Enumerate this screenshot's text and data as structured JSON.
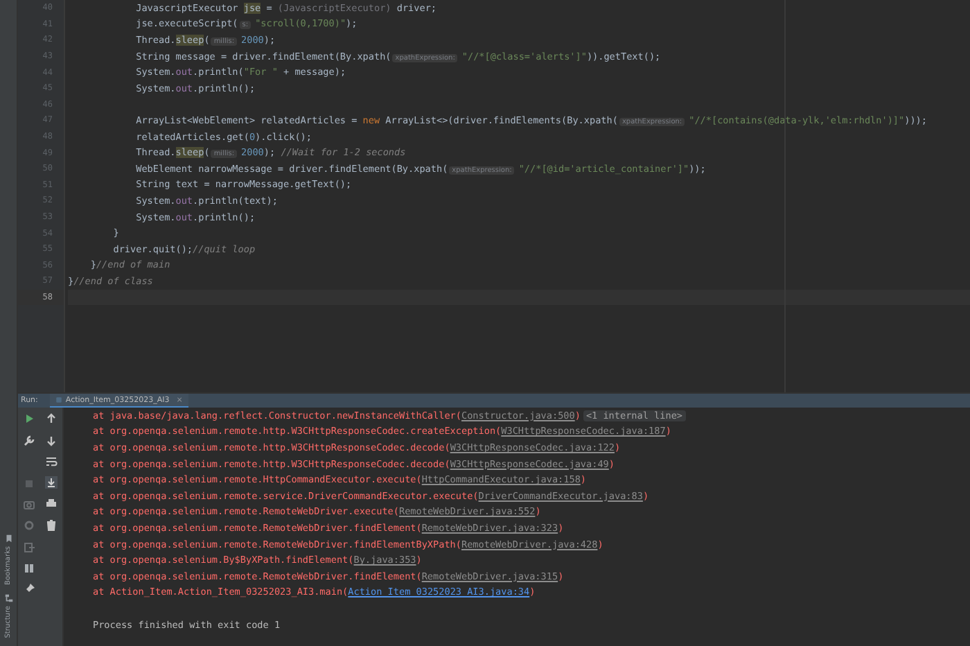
{
  "editor": {
    "lines": [
      {
        "number": "40",
        "current": false,
        "segments": [
          {
            "kind": "plain",
            "text": "            JavascriptExecutor "
          },
          {
            "kind": "highlight",
            "text": "jse"
          },
          {
            "kind": "plain",
            "text": " = "
          },
          {
            "kind": "dim",
            "text": "(JavascriptExecutor)"
          },
          {
            "kind": "plain",
            "text": " driver;"
          }
        ]
      },
      {
        "number": "41",
        "current": false,
        "segments": [
          {
            "kind": "plain",
            "text": "            jse.executeScript("
          },
          {
            "kind": "hint",
            "text": "s:"
          },
          {
            "kind": "string",
            "text": "\"scroll(0,1700)\""
          },
          {
            "kind": "plain",
            "text": ");"
          }
        ]
      },
      {
        "number": "42",
        "current": false,
        "segments": [
          {
            "kind": "plain",
            "text": "            Thread."
          },
          {
            "kind": "highlight",
            "text": "sleep"
          },
          {
            "kind": "plain",
            "text": "("
          },
          {
            "kind": "hint",
            "text": "millis:"
          },
          {
            "kind": "number",
            "text": "2000"
          },
          {
            "kind": "plain",
            "text": ");"
          }
        ]
      },
      {
        "number": "43",
        "current": false,
        "segments": [
          {
            "kind": "plain",
            "text": "            String message = driver.findElement(By.xpath("
          },
          {
            "kind": "hint",
            "text": "xpathExpression:"
          },
          {
            "kind": "string",
            "text": "\"//*[@class='alerts']\""
          },
          {
            "kind": "plain",
            "text": ")).getText();"
          }
        ]
      },
      {
        "number": "44",
        "current": false,
        "segments": [
          {
            "kind": "plain",
            "text": "            System."
          },
          {
            "kind": "field",
            "text": "out"
          },
          {
            "kind": "plain",
            "text": ".println("
          },
          {
            "kind": "string",
            "text": "\"For \""
          },
          {
            "kind": "plain",
            "text": " + message);"
          }
        ]
      },
      {
        "number": "45",
        "current": false,
        "segments": [
          {
            "kind": "plain",
            "text": "            System."
          },
          {
            "kind": "field",
            "text": "out"
          },
          {
            "kind": "plain",
            "text": ".println();"
          }
        ]
      },
      {
        "number": "46",
        "current": false
      },
      {
        "number": "47",
        "current": false,
        "segments": [
          {
            "kind": "plain",
            "text": "            ArrayList<WebElement> relatedArticles = "
          },
          {
            "kind": "keyword",
            "text": "new"
          },
          {
            "kind": "plain",
            "text": " ArrayList<>(driver.findElements(By.xpath("
          },
          {
            "kind": "hint",
            "text": "xpathExpression:"
          },
          {
            "kind": "string",
            "text": "\"//*[contains(@data-ylk,'elm:rhdln')]\""
          },
          {
            "kind": "plain",
            "text": ")));"
          }
        ]
      },
      {
        "number": "48",
        "current": false,
        "segments": [
          {
            "kind": "plain",
            "text": "            relatedArticles.get("
          },
          {
            "kind": "number",
            "text": "0"
          },
          {
            "kind": "plain",
            "text": ").click();"
          }
        ]
      },
      {
        "number": "49",
        "current": false,
        "segments": [
          {
            "kind": "plain",
            "text": "            Thread."
          },
          {
            "kind": "highlight",
            "text": "sleep"
          },
          {
            "kind": "plain",
            "text": "("
          },
          {
            "kind": "hint",
            "text": "millis:"
          },
          {
            "kind": "number",
            "text": "2000"
          },
          {
            "kind": "plain",
            "text": "); "
          },
          {
            "kind": "comment",
            "text": "//Wait for 1-2 seconds"
          }
        ]
      },
      {
        "number": "50",
        "current": false,
        "segments": [
          {
            "kind": "plain",
            "text": "            WebElement narrowMessage = driver.findElement(By.xpath("
          },
          {
            "kind": "hint",
            "text": "xpathExpression:"
          },
          {
            "kind": "string",
            "text": "\"//*[@id='article_container']\""
          },
          {
            "kind": "plain",
            "text": "));"
          }
        ]
      },
      {
        "number": "51",
        "current": false,
        "segments": [
          {
            "kind": "plain",
            "text": "            String text = narrowMessage.getText();"
          }
        ]
      },
      {
        "number": "52",
        "current": false,
        "segments": [
          {
            "kind": "plain",
            "text": "            System."
          },
          {
            "kind": "field",
            "text": "out"
          },
          {
            "kind": "plain",
            "text": ".println(text);"
          }
        ]
      },
      {
        "number": "53",
        "current": false,
        "segments": [
          {
            "kind": "plain",
            "text": "            System."
          },
          {
            "kind": "field",
            "text": "out"
          },
          {
            "kind": "plain",
            "text": ".println();"
          }
        ]
      },
      {
        "number": "54",
        "current": false,
        "segments": [
          {
            "kind": "plain",
            "text": "        }"
          }
        ]
      },
      {
        "number": "55",
        "current": false,
        "segments": [
          {
            "kind": "plain",
            "text": "        driver.quit();"
          },
          {
            "kind": "comment",
            "text": "//quit loop"
          }
        ]
      },
      {
        "number": "56",
        "current": false,
        "segments": [
          {
            "kind": "plain",
            "text": "    }"
          },
          {
            "kind": "comment",
            "text": "//end of main"
          }
        ]
      },
      {
        "number": "57",
        "current": false,
        "segments": [
          {
            "kind": "plain",
            "text": "}"
          },
          {
            "kind": "comment",
            "text": "//end of class"
          }
        ]
      },
      {
        "number": "58",
        "current": true
      }
    ]
  },
  "run_panel": {
    "label": "Run:",
    "tabs": [
      {
        "label": "Action_Item_03252023_AI3",
        "close": "×",
        "selected": true
      }
    ],
    "console": [
      {
        "kind": "error",
        "text": "at java.base/java.lang.reflect.Constructor.newInstanceWithCaller(",
        "link": "Constructor.java:500",
        "project_link": false,
        "tail": ")",
        "note": "<1 internal line>"
      },
      {
        "kind": "error",
        "text": "at org.openqa.selenium.remote.http.W3CHttpResponseCodec.createException(",
        "link": "W3CHttpResponseCodec.java:187",
        "project_link": false,
        "tail": ")"
      },
      {
        "kind": "error",
        "text": "at org.openqa.selenium.remote.http.W3CHttpResponseCodec.decode(",
        "link": "W3CHttpResponseCodec.java:122",
        "project_link": false,
        "tail": ")"
      },
      {
        "kind": "error",
        "text": "at org.openqa.selenium.remote.http.W3CHttpResponseCodec.decode(",
        "link": "W3CHttpResponseCodec.java:49",
        "project_link": false,
        "tail": ")"
      },
      {
        "kind": "error",
        "text": "at org.openqa.selenium.remote.HttpCommandExecutor.execute(",
        "link": "HttpCommandExecutor.java:158",
        "project_link": false,
        "tail": ")"
      },
      {
        "kind": "error",
        "text": "at org.openqa.selenium.remote.service.DriverCommandExecutor.execute(",
        "link": "DriverCommandExecutor.java:83",
        "project_link": false,
        "tail": ")"
      },
      {
        "kind": "error",
        "text": "at org.openqa.selenium.remote.RemoteWebDriver.execute(",
        "link": "RemoteWebDriver.java:552",
        "project_link": false,
        "tail": ")"
      },
      {
        "kind": "error",
        "text": "at org.openqa.selenium.remote.RemoteWebDriver.findElement(",
        "link": "RemoteWebDriver.java:323",
        "project_link": false,
        "tail": ")"
      },
      {
        "kind": "error",
        "text": "at org.openqa.selenium.remote.RemoteWebDriver.findElementByXPath(",
        "link": "RemoteWebDriver.java:428",
        "project_link": false,
        "tail": ")"
      },
      {
        "kind": "error",
        "text": "at org.openqa.selenium.By$ByXPath.findElement(",
        "link": "By.java:353",
        "project_link": false,
        "tail": ")"
      },
      {
        "kind": "error",
        "text": "at org.openqa.selenium.remote.RemoteWebDriver.findElement(",
        "link": "RemoteWebDriver.java:315",
        "project_link": false,
        "tail": ")"
      },
      {
        "kind": "error",
        "text": "at Action_Item.Action_Item_03252023_AI3.main(",
        "link": "Action_Item_03252023_AI3.java:34",
        "project_link": true,
        "tail": ")"
      },
      {
        "kind": "blank"
      },
      {
        "kind": "info",
        "text": "Process finished with exit code 1"
      }
    ]
  },
  "side_strip": {
    "labels": [
      "Bookmarks",
      "Structure"
    ]
  }
}
